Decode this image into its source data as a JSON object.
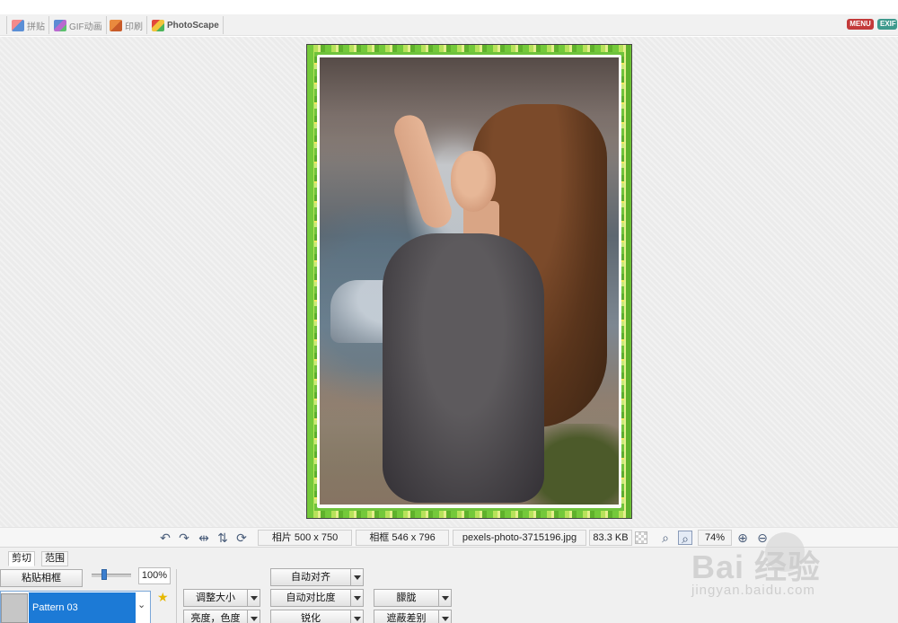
{
  "tabs": [
    {
      "label": "拼贴",
      "icon": "collage-icon"
    },
    {
      "label": "GIF动画",
      "icon": "gif-animation-icon"
    },
    {
      "label": "印刷",
      "icon": "print-icon"
    },
    {
      "label": "PhotoScape",
      "icon": "photoscape-icon"
    }
  ],
  "header": {
    "menu_badge": "MENU",
    "exif_badge": "EXIF"
  },
  "status": {
    "photo_size": "相片 500 x 750",
    "frame_size": "相框 546 x 796",
    "filename": "pexels-photo-3715196.jpg",
    "filesize": "83.3 KB",
    "zoom": "74%"
  },
  "panel": {
    "tabs": [
      "剪切",
      "范围"
    ],
    "paste_frame": "粘贴相框",
    "opacity_value": "100%",
    "opacity_level": 0.3,
    "pattern_name": "Pattern 03",
    "buttons": {
      "auto_level": "自动对齐",
      "resize": "调整大小",
      "auto_contrast": "自动对比度",
      "blur": "朦胧",
      "brightness": "亮度，色度",
      "sharpen": "锐化",
      "mask": "遮蔽差别"
    }
  },
  "watermark": {
    "main": "Bai 经验",
    "sub": "jingyan.baidu.com"
  },
  "colors": {
    "accent_blue": "#1c7ad6",
    "menu_red": "#c33a3a",
    "exif_teal": "#3e9a8d",
    "frame_green": "#74c93a"
  }
}
